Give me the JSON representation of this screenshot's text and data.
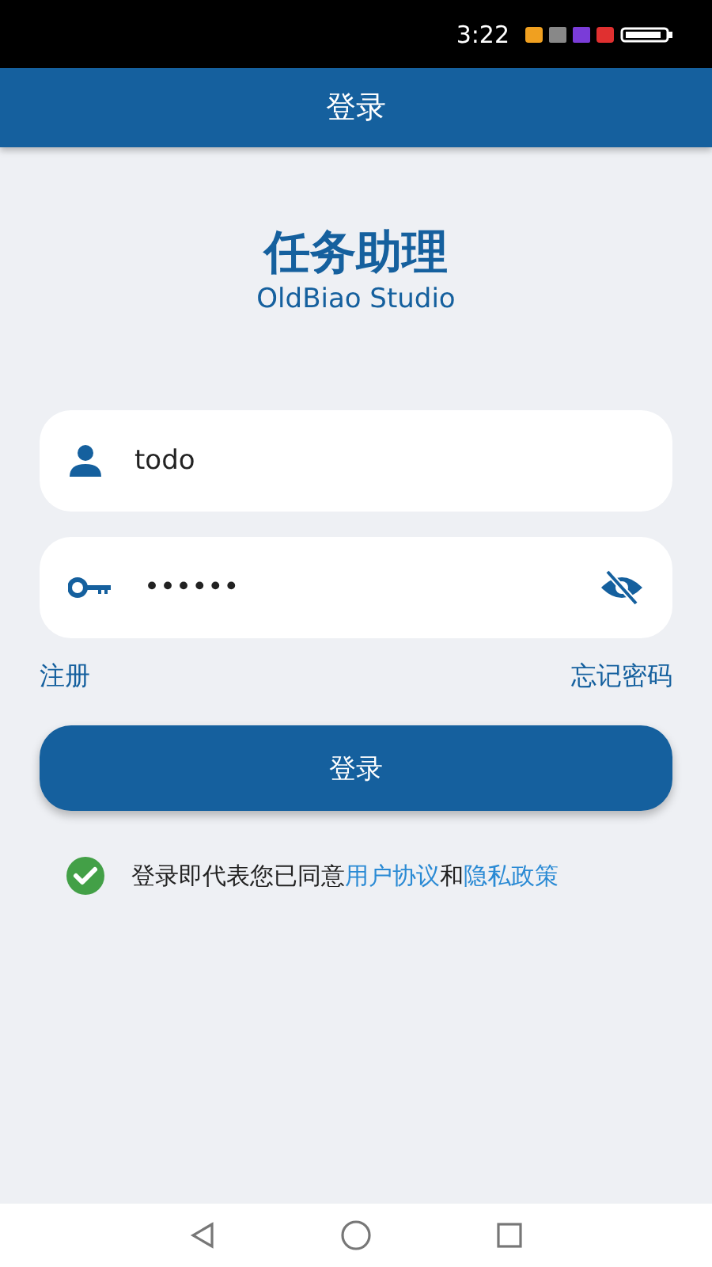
{
  "status_bar": {
    "time": "3:22"
  },
  "app_bar": {
    "title": "登录"
  },
  "header": {
    "title": "任务助理",
    "subtitle": "OldBiao Studio"
  },
  "username": {
    "value": "todo"
  },
  "password": {
    "value": "••••••",
    "visible": false
  },
  "links": {
    "register": "注册",
    "forgot": "忘记密码"
  },
  "login_button": "登录",
  "agreement": {
    "checked": true,
    "text": "登录即代表您已同意",
    "link_1": "用户协议",
    "joiner": "和",
    "link_2": "隐私政策"
  }
}
